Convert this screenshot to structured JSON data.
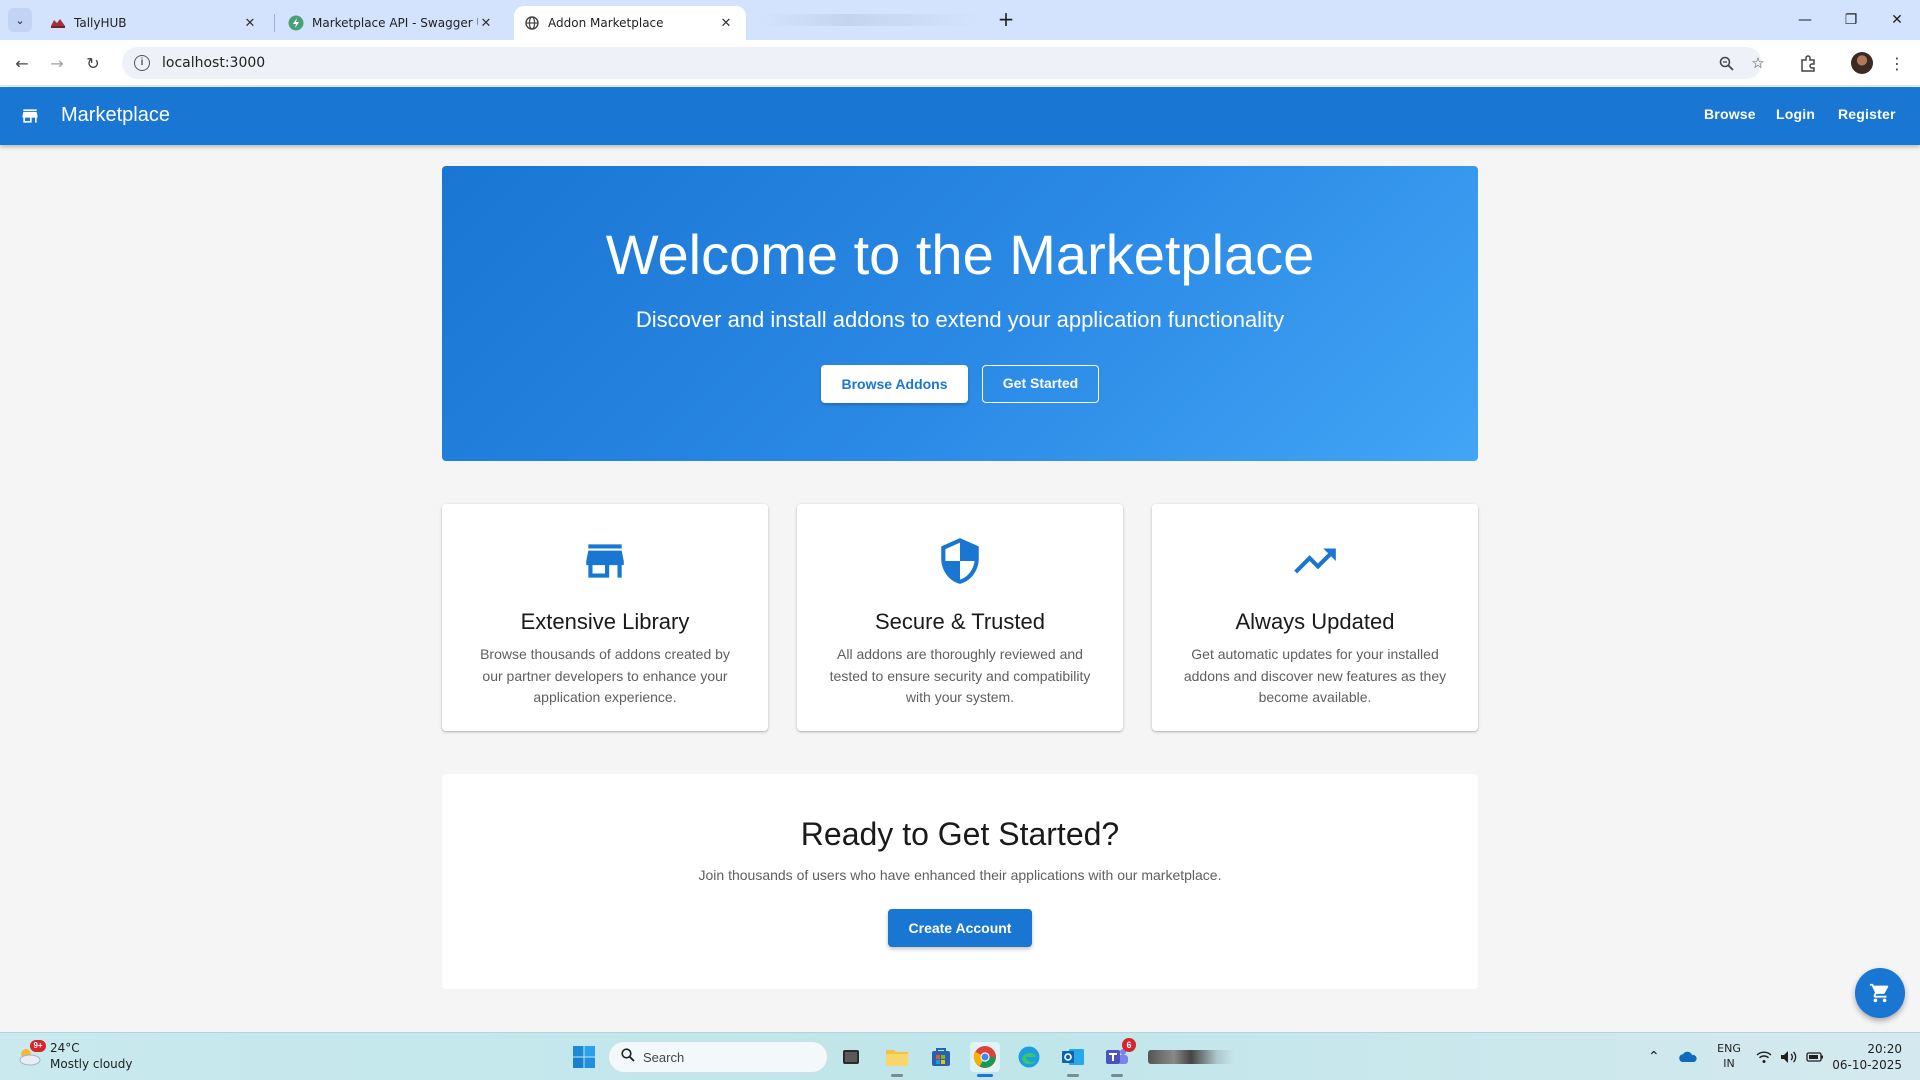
{
  "browser": {
    "tabs": [
      {
        "title": "TallyHUB",
        "icon": "tallyhub-icon",
        "active": false
      },
      {
        "title": "Marketplace API - Swagger UI",
        "icon": "swagger-icon",
        "active": false
      },
      {
        "title": "Addon Marketplace",
        "icon": "globe-icon",
        "active": true
      }
    ],
    "url": "localhost:3000"
  },
  "appbar": {
    "brand": "Marketplace",
    "nav": {
      "browse": "Browse",
      "login": "Login",
      "register": "Register"
    }
  },
  "hero": {
    "title": "Welcome to the Marketplace",
    "subtitle": "Discover and install addons to extend your application functionality",
    "primary_button": "Browse Addons",
    "secondary_button": "Get Started"
  },
  "features": [
    {
      "icon": "storefront-icon",
      "title": "Extensive Library",
      "text": "Browse thousands of addons created by our partner developers to enhance your application experience."
    },
    {
      "icon": "shield-icon",
      "title": "Secure & Trusted",
      "text": "All addons are thoroughly reviewed and tested to ensure security and compatibility with your system."
    },
    {
      "icon": "trending-up-icon",
      "title": "Always Updated",
      "text": "Get automatic updates for your installed addons and discover new features as they become available."
    }
  ],
  "cta": {
    "title": "Ready to Get Started?",
    "text": "Join thousands of users who have enhanced their applications with our marketplace.",
    "button": "Create Account"
  },
  "taskbar": {
    "weather": {
      "temp": "24°C",
      "condition": "Mostly cloudy",
      "badge": "9+"
    },
    "search_placeholder": "Search",
    "teams_badge": "6",
    "language": {
      "line1": "ENG",
      "line2": "IN"
    },
    "clock": {
      "time": "20:20",
      "date": "06-10-2025"
    }
  },
  "colors": {
    "primary": "#1976d2",
    "hero_end": "#42a5f5",
    "background": "#f5f5f5"
  }
}
